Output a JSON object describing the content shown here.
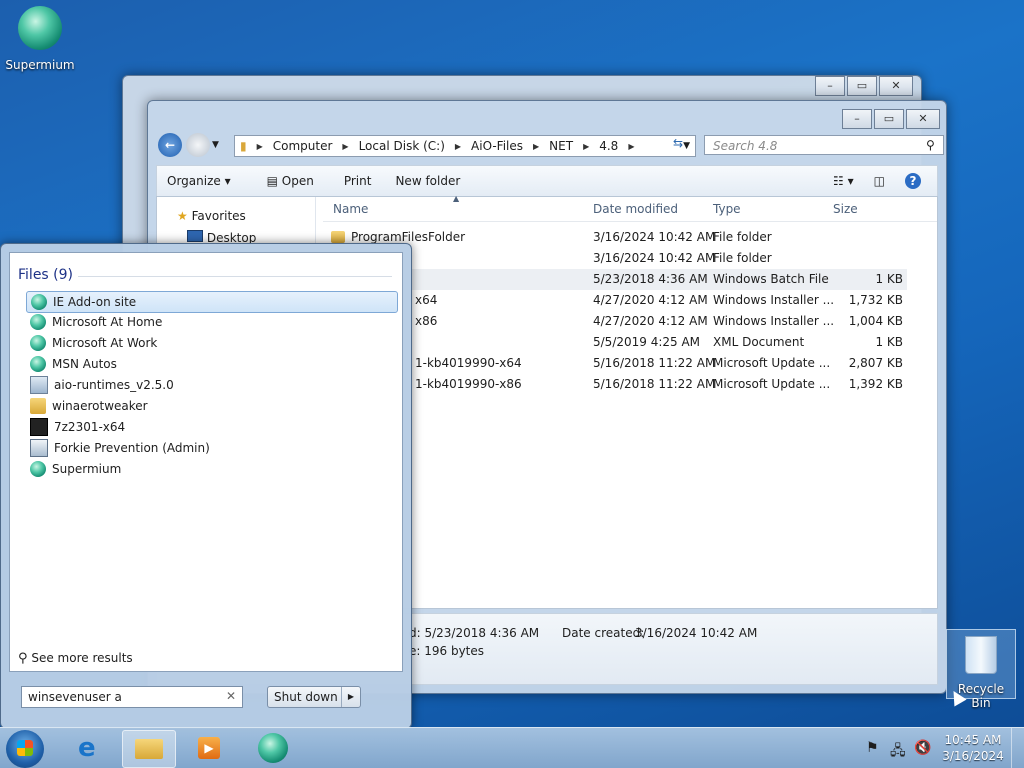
{
  "desktop": {
    "icons": [
      {
        "label": "Supermium"
      },
      {
        "label": "Recycle Bin"
      }
    ]
  },
  "explorer": {
    "breadcrumb": [
      "Computer",
      "Local Disk (C:)",
      "AiO-Files",
      "NET",
      "4.8"
    ],
    "search_placeholder": "Search 4.8",
    "toolbar": {
      "organize": "Organize",
      "open": "Open",
      "print": "Print",
      "new_folder": "New folder"
    },
    "nav": {
      "favorites": "Favorites",
      "desktop": "Desktop"
    },
    "columns": {
      "name": "Name",
      "date": "Date modified",
      "type": "Type",
      "size": "Size"
    },
    "rows": [
      {
        "name": "ProgramFilesFolder",
        "date": "3/16/2024 10:42 AM",
        "type": "File folder",
        "size": ""
      },
      {
        "name": "",
        "date": "3/16/2024 10:42 AM",
        "type": "File folder",
        "size": ""
      },
      {
        "name": "",
        "date": "5/23/2018 4:36 AM",
        "type": "Windows Batch File",
        "size": "1 KB"
      },
      {
        "name": "x64",
        "date": "4/27/2020 4:12 AM",
        "type": "Windows Installer ...",
        "size": "1,732 KB"
      },
      {
        "name": "x86",
        "date": "4/27/2020 4:12 AM",
        "type": "Windows Installer ...",
        "size": "1,004 KB"
      },
      {
        "name": "",
        "date": "5/5/2019 4:25 AM",
        "type": "XML Document",
        "size": "1 KB"
      },
      {
        "name": "1-kb4019990-x64",
        "date": "5/16/2018 11:22 AM",
        "type": "Microsoft Update ...",
        "size": "2,807 KB"
      },
      {
        "name": "1-kb4019990-x86",
        "date": "5/16/2018 11:22 AM",
        "type": "Microsoft Update ...",
        "size": "1,392 KB"
      }
    ],
    "details": {
      "modified": "d: 5/23/2018 4:36 AM",
      "created_label": "Date created:",
      "created": "3/16/2024 10:42 AM",
      "size": "e: 196 bytes"
    }
  },
  "start_menu": {
    "heading": "Files (9)",
    "results": [
      {
        "label": "IE Add-on site",
        "icon": "supermium-icon"
      },
      {
        "label": "Microsoft At Home",
        "icon": "supermium-icon"
      },
      {
        "label": "Microsoft At Work",
        "icon": "supermium-icon"
      },
      {
        "label": "MSN Autos",
        "icon": "supermium-icon"
      },
      {
        "label": "aio-runtimes_v2.5.0",
        "icon": "setup-icon"
      },
      {
        "label": "winaerotweaker",
        "icon": "folder-zip-icon"
      },
      {
        "label": "7z2301-x64",
        "icon": "7zip-icon"
      },
      {
        "label": "Forkie Prevention (Admin)",
        "icon": "app-icon"
      },
      {
        "label": "Supermium",
        "icon": "supermium-icon"
      }
    ],
    "see_more": "See more results",
    "search_value": "winsevenuser a",
    "shutdown": "Shut down"
  },
  "tray": {
    "time": "10:45 AM",
    "date": "3/16/2024"
  },
  "colors": {
    "accent": "#1b73c8",
    "selection": "#cfe4f8"
  }
}
